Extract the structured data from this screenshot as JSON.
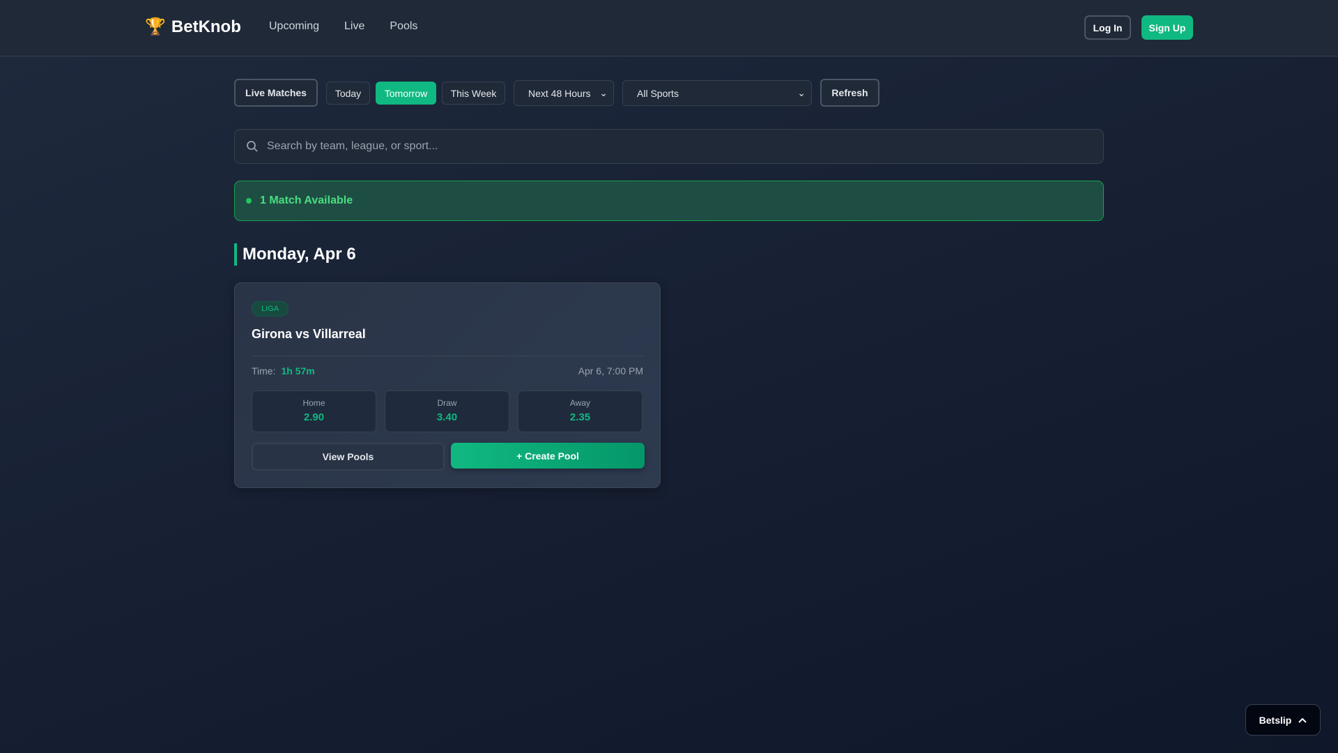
{
  "header": {
    "logo_icon": "trophy-icon",
    "logo_emoji": "🏆",
    "brand": "BetKnob",
    "nav": [
      "Upcoming",
      "Live",
      "Pools"
    ],
    "login": "Log In",
    "signup": "Sign Up"
  },
  "filters": {
    "live_matches": "Live Matches",
    "today": "Today",
    "tomorrow": "Tomorrow",
    "this_week": "This Week",
    "range_select": "Next 48 Hours",
    "sport_select": "All Sports",
    "refresh": "Refresh",
    "active": "Tomorrow"
  },
  "search": {
    "placeholder": "Search by team, league, or sport...",
    "value": ""
  },
  "banner": {
    "text": "1 Match Available"
  },
  "day_heading": "Monday, Apr 6",
  "match": {
    "league": "LIGA",
    "title": "Girona vs Villarreal",
    "time_label": "Time:",
    "countdown": "1h 57m",
    "datetime": "Apr 6, 7:00 PM",
    "odds": [
      {
        "label": "Home",
        "value": "2.90"
      },
      {
        "label": "Draw",
        "value": "3.40"
      },
      {
        "label": "Away",
        "value": "2.35"
      }
    ],
    "view_pools": "View Pools",
    "create_pool": "+ Create Pool"
  },
  "betslip": {
    "label": "Betslip"
  },
  "colors": {
    "accent": "#10b981",
    "background": "#172033"
  }
}
